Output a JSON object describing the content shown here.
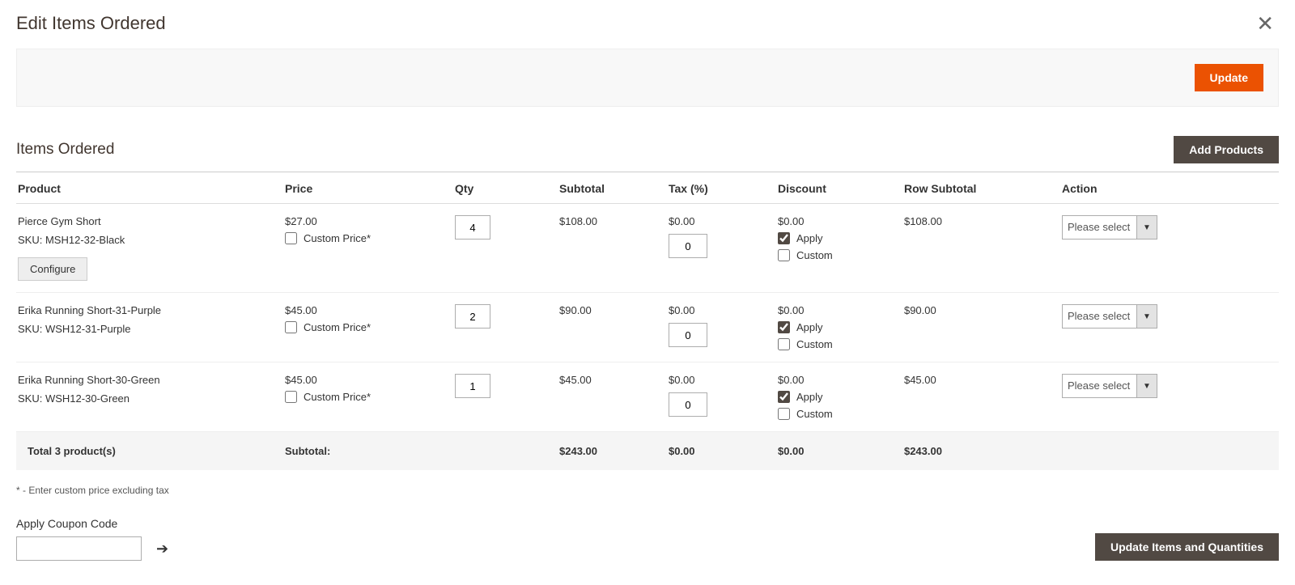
{
  "header": {
    "title": "Edit Items Ordered",
    "update_btn": "Update"
  },
  "section": {
    "title": "Items Ordered",
    "add_products_btn": "Add Products"
  },
  "columns": {
    "product": "Product",
    "price": "Price",
    "qty": "Qty",
    "subtotal": "Subtotal",
    "tax": "Tax (%)",
    "discount": "Discount",
    "row_subtotal": "Row Subtotal",
    "action": "Action"
  },
  "labels": {
    "sku_prefix": "SKU: ",
    "configure": "Configure",
    "custom_price": "Custom Price*",
    "apply": "Apply",
    "custom": "Custom",
    "action_placeholder": "Please select"
  },
  "items": [
    {
      "name": "Pierce Gym Short",
      "sku": "MSH12-32-Black",
      "configurable": true,
      "price": "$27.00",
      "custom_price_checked": false,
      "qty": "4",
      "subtotal": "$108.00",
      "tax_amount": "$0.00",
      "tax_percent": "0",
      "discount_amount": "$0.00",
      "discount_apply": true,
      "discount_custom": false,
      "row_subtotal": "$108.00"
    },
    {
      "name": "Erika Running Short-31-Purple",
      "sku": "WSH12-31-Purple",
      "configurable": false,
      "price": "$45.00",
      "custom_price_checked": false,
      "qty": "2",
      "subtotal": "$90.00",
      "tax_amount": "$0.00",
      "tax_percent": "0",
      "discount_amount": "$0.00",
      "discount_apply": true,
      "discount_custom": false,
      "row_subtotal": "$90.00"
    },
    {
      "name": "Erika Running Short-30-Green",
      "sku": "WSH12-30-Green",
      "configurable": false,
      "price": "$45.00",
      "custom_price_checked": false,
      "qty": "1",
      "subtotal": "$45.00",
      "tax_amount": "$0.00",
      "tax_percent": "0",
      "discount_amount": "$0.00",
      "discount_apply": true,
      "discount_custom": false,
      "row_subtotal": "$45.00"
    }
  ],
  "totals": {
    "label": "Total 3 product(s)",
    "subtotal_label": "Subtotal:",
    "subtotal": "$243.00",
    "tax": "$0.00",
    "discount": "$0.00",
    "row_subtotal": "$243.00"
  },
  "footnote": "* - Enter custom price excluding tax",
  "coupon": {
    "label": "Apply Coupon Code",
    "value": ""
  },
  "update_items_btn": "Update Items and Quantities"
}
